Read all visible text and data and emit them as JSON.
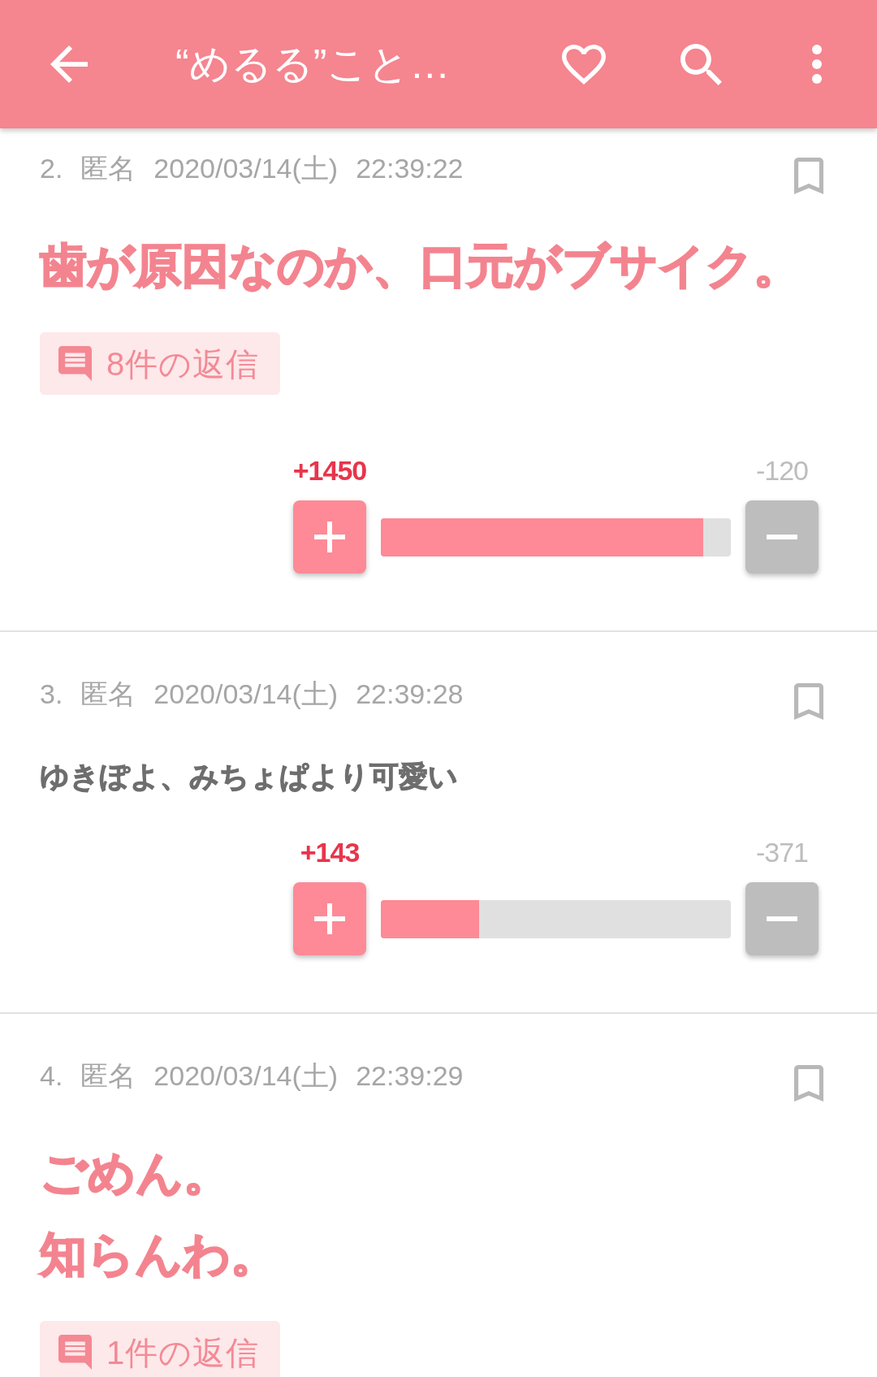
{
  "app_bar": {
    "title": "“めるる”こと…"
  },
  "posts": [
    {
      "number": "2.",
      "name": "匿名",
      "date": "2020/03/14(土)",
      "time": "22:39:22",
      "bookmarked": false,
      "kind": "large",
      "lines": [
        "歯が原因なのか、口元がブサイク。"
      ],
      "replies": "8件の返信",
      "votes": {
        "plus": "+1450",
        "minus": "-120",
        "level": 0.92
      }
    },
    {
      "number": "3.",
      "name": "匿名",
      "date": "2020/03/14(土)",
      "time": "22:39:28",
      "bookmarked": false,
      "kind": "plain",
      "lines": [
        "ゆきぽよ、みちょぱより可愛い"
      ],
      "votes": {
        "plus": "+143",
        "minus": "-371",
        "level": 0.28
      }
    },
    {
      "number": "4.",
      "name": "匿名",
      "date": "2020/03/14(土)",
      "time": "22:39:29",
      "bookmarked": false,
      "kind": "large",
      "lines": [
        "ごめん。",
        "知らんわ。"
      ],
      "replies": "1件の返信"
    }
  ]
}
